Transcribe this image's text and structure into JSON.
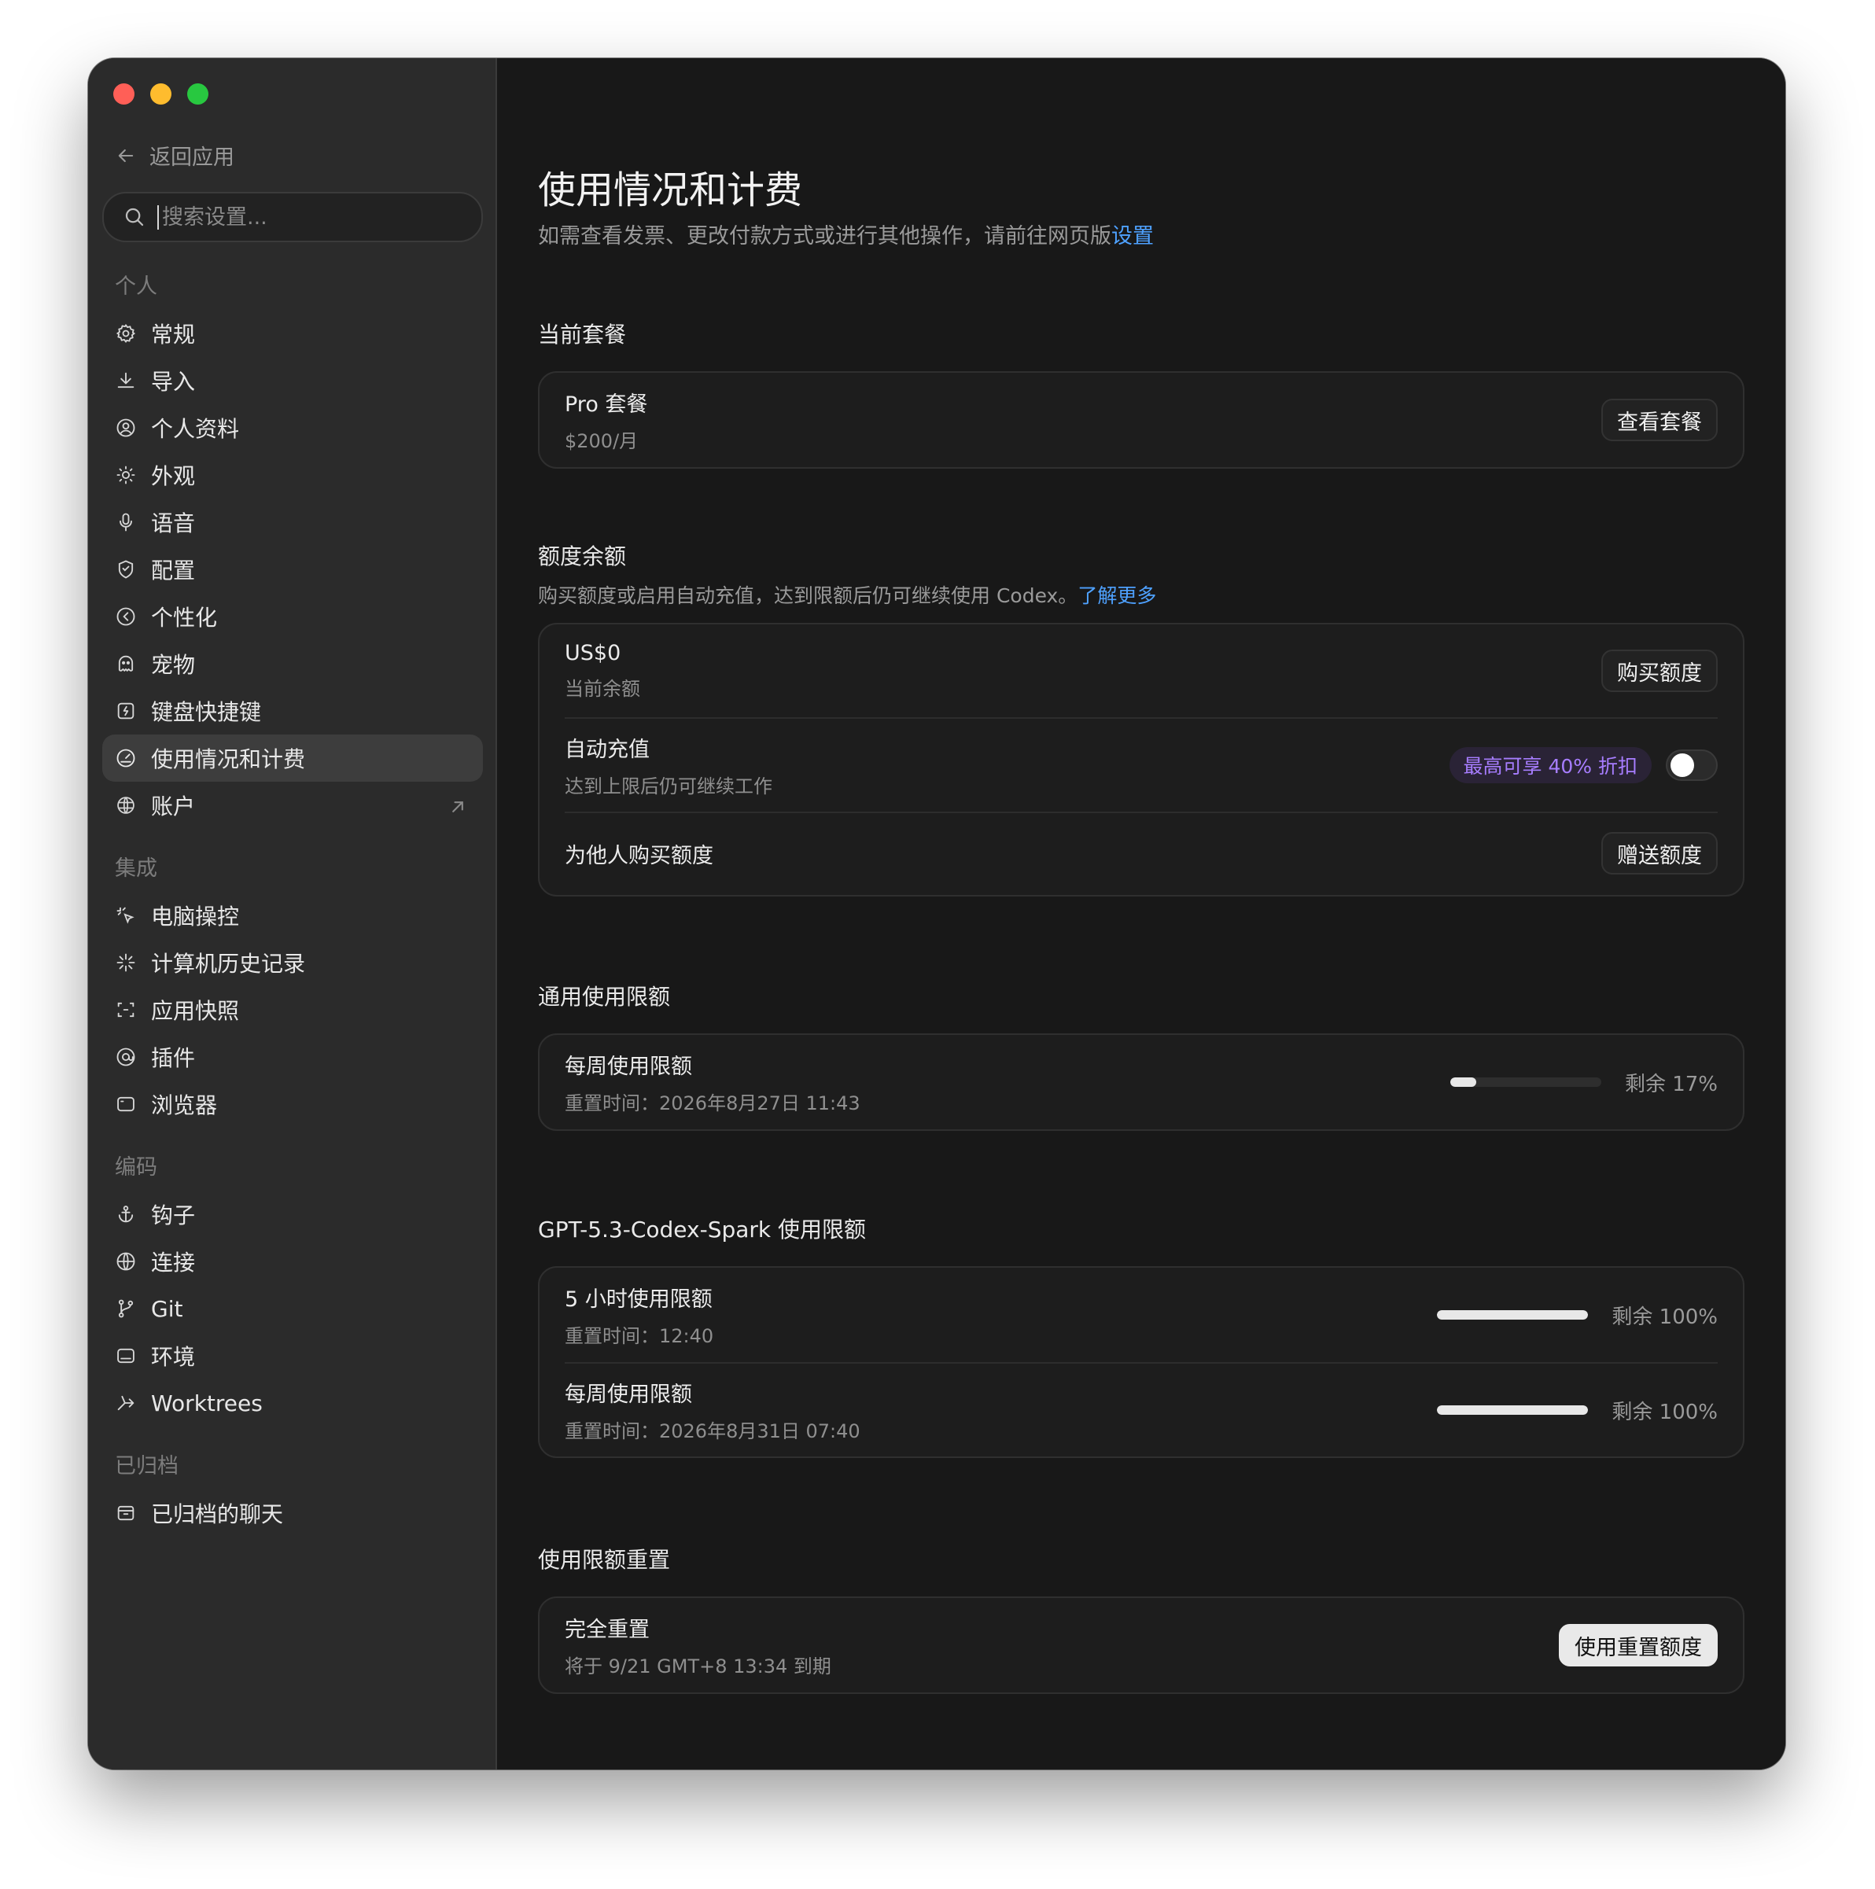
{
  "sidebar": {
    "back_label": "返回应用",
    "search_placeholder": "搜索设置...",
    "sections": [
      {
        "title": "个人",
        "items": [
          {
            "label": "常规",
            "icon": "gear-icon"
          },
          {
            "label": "导入",
            "icon": "download-icon"
          },
          {
            "label": "个人资料",
            "icon": "profile-icon"
          },
          {
            "label": "外观",
            "icon": "sun-icon"
          },
          {
            "label": "语音",
            "icon": "microphone-icon"
          },
          {
            "label": "配置",
            "icon": "config-icon"
          },
          {
            "label": "个性化",
            "icon": "personalize-icon"
          },
          {
            "label": "宠物",
            "icon": "pet-icon"
          },
          {
            "label": "键盘快捷键",
            "icon": "keyboard-icon"
          },
          {
            "label": "使用情况和计费",
            "icon": "gauge-icon",
            "active": true
          },
          {
            "label": "账户",
            "icon": "account-icon",
            "external": true
          }
        ]
      },
      {
        "title": "集成",
        "items": [
          {
            "label": "电脑操控",
            "icon": "cursor-sparkle-icon"
          },
          {
            "label": "计算机历史记录",
            "icon": "history-burst-icon"
          },
          {
            "label": "应用快照",
            "icon": "snapshot-icon"
          },
          {
            "label": "插件",
            "icon": "plugin-icon"
          },
          {
            "label": "浏览器",
            "icon": "browser-icon"
          }
        ]
      },
      {
        "title": "编码",
        "items": [
          {
            "label": "钩子",
            "icon": "anchor-icon"
          },
          {
            "label": "连接",
            "icon": "globe-icon"
          },
          {
            "label": "Git",
            "icon": "git-branch-icon"
          },
          {
            "label": "环境",
            "icon": "environment-icon"
          },
          {
            "label": "Worktrees",
            "icon": "worktree-icon"
          }
        ]
      },
      {
        "title": "已归档",
        "items": [
          {
            "label": "已归档的聊天",
            "icon": "archive-icon"
          }
        ]
      }
    ]
  },
  "main": {
    "title": "使用情况和计费",
    "subtitle_prefix": "如需查看发票、更改付款方式或进行其他操作，请前往网页版",
    "subtitle_link": "设置",
    "plan": {
      "heading": "当前套餐",
      "name": "Pro 套餐",
      "price": "$200/月",
      "button": "查看套餐"
    },
    "credits": {
      "heading": "额度余额",
      "desc_prefix": "购买额度或启用自动充值，达到限额后仍可继续使用 Codex。",
      "desc_link": "了解更多",
      "balance_value": "US$0",
      "balance_label": "当前余额",
      "buy_button": "购买额度",
      "auto_title": "自动充值",
      "auto_desc": "达到上限后仍可继续工作",
      "promo": "最高可享 40% 折扣",
      "auto_enabled": false,
      "gift_title": "为他人购买额度",
      "gift_button": "赠送额度"
    },
    "general_limits": {
      "heading": "通用使用限额",
      "items": [
        {
          "title": "每周使用限额",
          "reset": "重置时间：2026年8月27日 11:43",
          "remaining_pct": 17,
          "remaining_label": "剩余 17%"
        }
      ]
    },
    "spark_limits": {
      "heading": "GPT-5.3-Codex-Spark 使用限额",
      "items": [
        {
          "title": "5 小时使用限额",
          "reset": "重置时间：12:40",
          "remaining_pct": 100,
          "remaining_label": "剩余 100%"
        },
        {
          "title": "每周使用限额",
          "reset": "重置时间：2026年8月31日 07:40",
          "remaining_pct": 100,
          "remaining_label": "剩余 100%"
        }
      ]
    },
    "reset": {
      "heading": "使用限额重置",
      "title": "完全重置",
      "expiry": "将于 9/21 GMT+8 13:34 到期",
      "button": "使用重置额度"
    }
  },
  "colors": {
    "accent_link": "#4ea1ff",
    "promo_text": "#a77dff",
    "window_bg": "#181818",
    "sidebar_bg": "#2b2b2b"
  }
}
